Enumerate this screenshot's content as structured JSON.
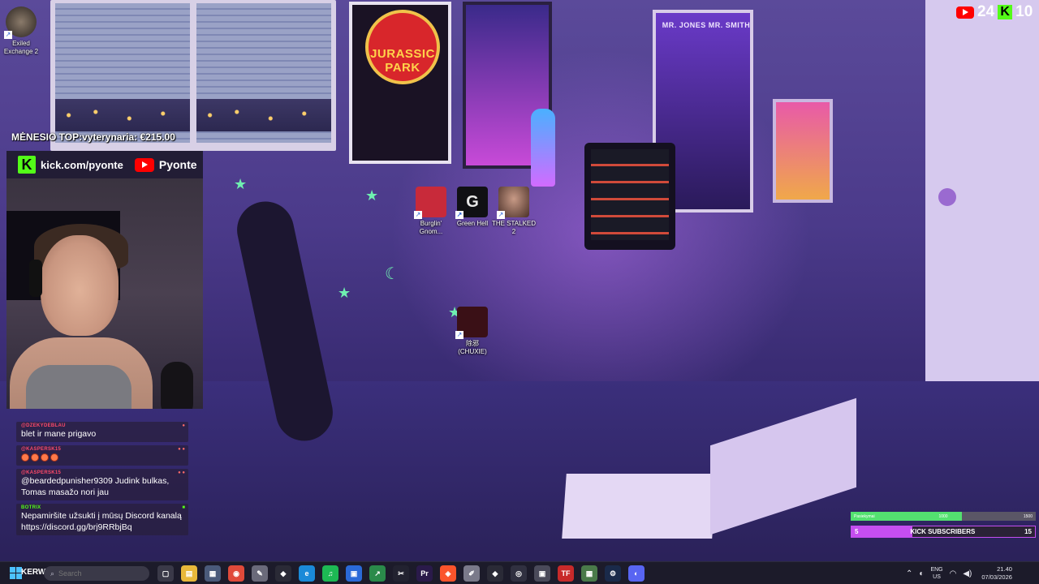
{
  "desktop": {
    "icons_top_left": [
      {
        "label_line1": "Exiled",
        "label_line2": "Exchange 2",
        "icon": "exiled-exchange-icon"
      }
    ],
    "icons_center": [
      {
        "label_line1": "Burglin'",
        "label_line2": "Gnom...",
        "icon": "burglin-gnomes-icon"
      },
      {
        "label_line1": "Green Hell",
        "label_line2": "",
        "icon": "green-hell-icon"
      },
      {
        "label_line1": "THE STALKED",
        "label_line2": "2",
        "icon": "the-stalked-2-icon"
      },
      {
        "label_line1": "除邪",
        "label_line2": "(CHUXIE)",
        "icon": "chuxie-icon"
      }
    ],
    "wallpaper": {
      "poster_jurassic_park": "JURASSIC PARK",
      "poster_mib": "MR. JONES  MR. SMITH"
    }
  },
  "overlay": {
    "youtube_counter": {
      "value": "24",
      "icon": "youtube-icon"
    },
    "kick_counter": {
      "value": "10",
      "icon": "kick-icon"
    },
    "donation_top": "MĖNESIO TOP:vyterynaria: €215.00",
    "cam_header": {
      "kick_url": "kick.com/pyonte",
      "youtube_name": "Pyonte"
    },
    "chat": [
      {
        "user": "@DZEKYDEBLAU",
        "text": "blet ir mane prigavo",
        "emotes": 0,
        "bot": false
      },
      {
        "user": "@KASPERSK15",
        "text": "",
        "emotes": 4,
        "bot": false
      },
      {
        "user": "@KASPERSK15",
        "text": "@beardedpunisher9309 Judink bulkas, Tomas masažo nori jau",
        "emotes": 0,
        "bot": false
      },
      {
        "user": "BOTRIX",
        "text": "Nepamiršite užsukti į mūsų Discord kanalą https://discord.gg/brj9RRbjBq",
        "emotes": 0,
        "bot": true
      }
    ],
    "goal_top": {
      "label": "Pasiekymai",
      "mid": "1000",
      "right": "1500",
      "progress": 0.6
    },
    "goal_subs": {
      "current": "5",
      "label": "KICK SUBSCRIBERS",
      "target": "15",
      "progress": 0.33
    },
    "colors": {
      "kick_green": "#53fc18",
      "youtube_red": "#ff0000",
      "goal_purple": "#c44ef0"
    }
  },
  "taskbar": {
    "start_label": "KERW",
    "search_placeholder": "Search",
    "apps": [
      {
        "name": "task-view-icon",
        "glyph": "▢",
        "color": "#3a3948"
      },
      {
        "name": "file-explorer-icon",
        "glyph": "▤",
        "color": "#e8b83a"
      },
      {
        "name": "calculator-icon",
        "glyph": "▦",
        "color": "#4a5a7a"
      },
      {
        "name": "chrome-icon",
        "glyph": "◉",
        "color": "#e04a3a"
      },
      {
        "name": "notepad-icon",
        "glyph": "✎",
        "color": "#6a6a7a"
      },
      {
        "name": "game-launcher-icon",
        "glyph": "◆",
        "color": "#2a2a36"
      },
      {
        "name": "edge-icon",
        "glyph": "e",
        "color": "#1a8ad8"
      },
      {
        "name": "spotify-icon",
        "glyph": "♫",
        "color": "#1db954"
      },
      {
        "name": "photos-icon",
        "glyph": "▣",
        "color": "#2a6ad8"
      },
      {
        "name": "stock-app-icon",
        "glyph": "↗",
        "color": "#2a8a4a"
      },
      {
        "name": "capcut-icon",
        "glyph": "✂",
        "color": "#222230"
      },
      {
        "name": "premiere-icon",
        "glyph": "Pr",
        "color": "#2a1a4a"
      },
      {
        "name": "brave-icon",
        "glyph": "◈",
        "color": "#fb542b"
      },
      {
        "name": "paint-icon",
        "glyph": "✐",
        "color": "#7a7a8a"
      },
      {
        "name": "game-icon-2",
        "glyph": "◆",
        "color": "#2a2a36"
      },
      {
        "name": "obs-icon",
        "glyph": "◎",
        "color": "#303040"
      },
      {
        "name": "recorder-icon",
        "glyph": "▣",
        "color": "#4a4a5a"
      },
      {
        "name": "tf-icon",
        "glyph": "TF",
        "color": "#c82a2a"
      },
      {
        "name": "grid-app-icon",
        "glyph": "▦",
        "color": "#4a7a4a"
      },
      {
        "name": "steam-icon",
        "glyph": "⚙",
        "color": "#1a2a4a"
      },
      {
        "name": "discord-icon",
        "glyph": "◐",
        "color": "#5865f2"
      }
    ],
    "tray": {
      "lang_line1": "ENG",
      "lang_line2": "US",
      "time": "21.40",
      "date": "07/03/2026"
    }
  }
}
